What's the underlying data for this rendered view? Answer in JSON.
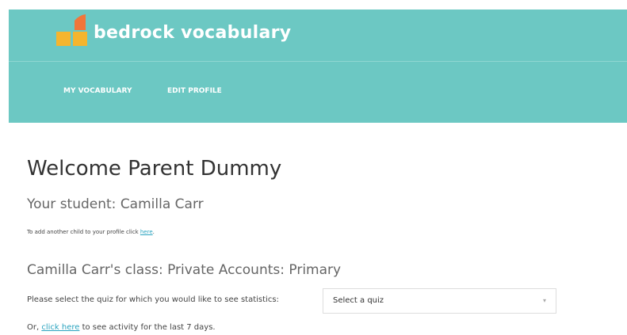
{
  "brand": {
    "name": "bedrock vocabulary",
    "colors": {
      "header_bg": "#6cc8c3",
      "logo_yellow": "#f5b52e",
      "logo_orange": "#f0763b"
    }
  },
  "nav": {
    "items": [
      {
        "label": "MY VOCABULARY"
      },
      {
        "label": "EDIT PROFILE"
      }
    ]
  },
  "main": {
    "title": "Welcome Parent Dummy",
    "student_line": "Your student: Camilla Carr",
    "add_child": {
      "prefix": "To add another child to your profile click ",
      "link": "here",
      "suffix": "."
    },
    "class_title": "Camilla Carr's class: Private Accounts: Primary",
    "quiz_prompt": "Please select the quiz for which you would like to see statistics:",
    "quiz_select": {
      "value": "Select a quiz",
      "icon": "chevron-down-icon"
    },
    "activity": {
      "prefix": "Or, ",
      "link": "click here",
      "suffix": " to see activity for the last 7 days."
    }
  }
}
